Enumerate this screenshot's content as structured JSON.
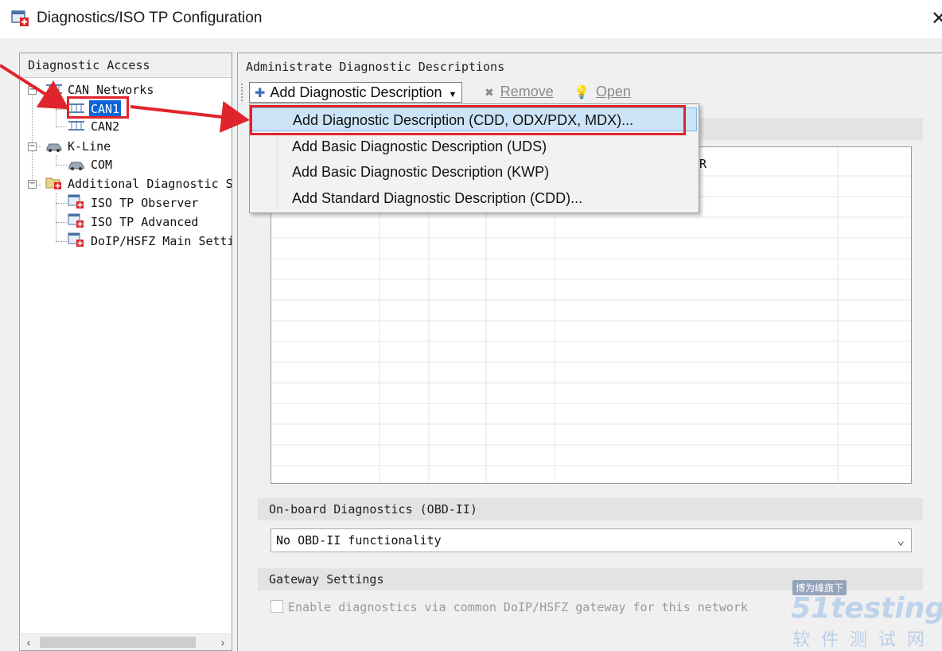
{
  "window": {
    "title": "Diagnostics/ISO TP Configuration",
    "close_glyph": "✕"
  },
  "left_panel": {
    "header": "Diagnostic Access",
    "tree": [
      {
        "label": "CAN Networks"
      },
      {
        "label": "CAN1"
      },
      {
        "label": "CAN2"
      },
      {
        "label": "K-Line"
      },
      {
        "label": "COM"
      },
      {
        "label": "Additional Diagnostic S"
      },
      {
        "label": "ISO TP Observer"
      },
      {
        "label": "ISO TP Advanced"
      },
      {
        "label": "DoIP/HSFZ Main Setti"
      }
    ],
    "selected": "CAN1"
  },
  "right_panel": {
    "header": "Administrate Diagnostic Descriptions",
    "toolbar": {
      "add_label": "Add Diagnostic Description",
      "remove_label": "Remove",
      "open_label": "Open"
    },
    "grid_column_fragment": "R",
    "obd_section": "On-board Diagnostics (OBD-II)",
    "obd_select_value": "No OBD-II functionality",
    "gateway_section": "Gateway Settings",
    "gateway_checkbox_label": "Enable diagnostics via common DoIP/HSFZ gateway for this network",
    "gateway_checkbox_checked": false,
    "gateway_checkbox_enabled": false
  },
  "dropdown_menu": {
    "items": [
      {
        "label": "Add Diagnostic Description (CDD, ODX/PDX, MDX)...",
        "highlighted": true
      },
      {
        "label": "Add Basic Diagnostic Description (UDS)",
        "highlighted": false
      },
      {
        "label": "Add Basic Diagnostic Description (KWP)",
        "highlighted": false
      },
      {
        "label": "Add Standard Diagnostic Description (CDD)...",
        "highlighted": false
      }
    ]
  },
  "watermark": {
    "badge": "博为峰旗下",
    "logo": "51testing",
    "sub": "软件测试网"
  },
  "colors": {
    "annotation_red": "#e0242b",
    "selection_blue": "#0a64d8",
    "menu_highlight": "#cce4f7"
  }
}
